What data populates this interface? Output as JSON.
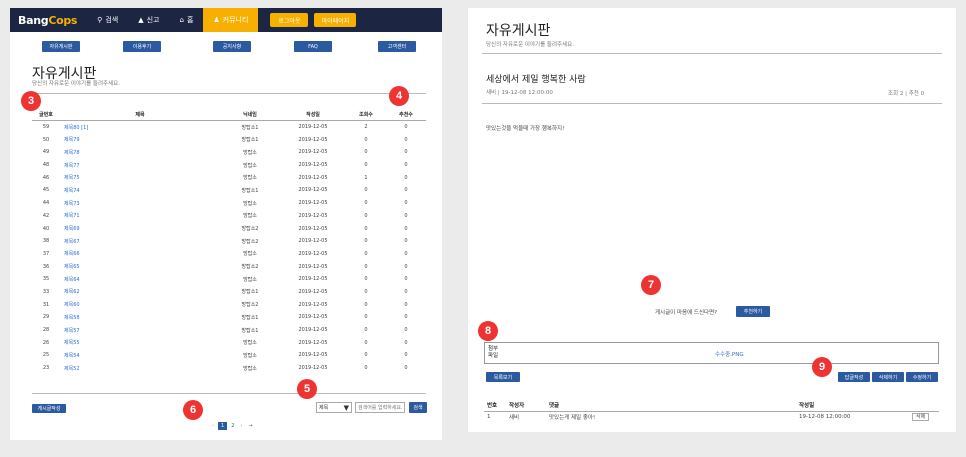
{
  "brand": {
    "left": "Bang",
    "right": "Cops"
  },
  "nav": {
    "search": "검색",
    "report": "신고",
    "home": "홈",
    "community": "커뮤니티",
    "logout": "로그아웃",
    "mypage": "마이페이지"
  },
  "subnav": [
    "자유게시판",
    "이용후기",
    "공지사항",
    "FAQ",
    "고객센터"
  ],
  "board": {
    "title": "자유게시판",
    "subtitle": "당신의 자유로운 이야기를 들려주세요.",
    "headers": [
      "글번호",
      "제목",
      "닉네임",
      "작성일",
      "조회수",
      "추천수"
    ],
    "rows": [
      [
        "59",
        "제목80 [1]",
        "방탑소1",
        "2019-12-05",
        "2",
        "0"
      ],
      [
        "50",
        "제목79",
        "방탑소1",
        "2019-12-05",
        "0",
        "0"
      ],
      [
        "49",
        "제목78",
        "방탑소",
        "2019-12-05",
        "0",
        "0"
      ],
      [
        "48",
        "제목77",
        "방탑소",
        "2019-12-05",
        "0",
        "0"
      ],
      [
        "46",
        "제목75",
        "방탑소",
        "2019-12-05",
        "1",
        "0"
      ],
      [
        "45",
        "제목74",
        "방탑소1",
        "2019-12-05",
        "0",
        "0"
      ],
      [
        "44",
        "제목73",
        "방탑소",
        "2019-12-05",
        "0",
        "0"
      ],
      [
        "42",
        "제목71",
        "방탑소",
        "2019-12-05",
        "0",
        "0"
      ],
      [
        "40",
        "제목69",
        "방탑소2",
        "2019-12-05",
        "0",
        "0"
      ],
      [
        "38",
        "제목67",
        "방탑소2",
        "2019-12-05",
        "0",
        "0"
      ],
      [
        "37",
        "제목66",
        "방탑소",
        "2019-12-05",
        "0",
        "0"
      ],
      [
        "36",
        "제목65",
        "방탑소2",
        "2019-12-05",
        "0",
        "0"
      ],
      [
        "35",
        "제목64",
        "방탑소",
        "2019-12-05",
        "0",
        "0"
      ],
      [
        "33",
        "제목62",
        "방탑소1",
        "2019-12-05",
        "0",
        "0"
      ],
      [
        "31",
        "제목60",
        "방탑소2",
        "2019-12-05",
        "0",
        "0"
      ],
      [
        "29",
        "제목58",
        "방탑소1",
        "2019-12-05",
        "0",
        "0"
      ],
      [
        "28",
        "제목57",
        "방탑소1",
        "2019-12-05",
        "0",
        "0"
      ],
      [
        "26",
        "제목55",
        "방탑소",
        "2019-12-05",
        "0",
        "0"
      ],
      [
        "25",
        "제목54",
        "방탑소",
        "2019-12-05",
        "0",
        "0"
      ],
      [
        "23",
        "제목52",
        "방탑소",
        "2019-12-05",
        "0",
        "0"
      ]
    ],
    "write_btn": "게시글작성",
    "search_select": "제목",
    "search_placeholder": "검색어를 입력하세요.",
    "search_btn": "검색",
    "pages": [
      "‹",
      "1",
      "2",
      "›",
      "→"
    ]
  },
  "post": {
    "board_title": "자유게시판",
    "board_sub": "당신의 자유로운 이야기를 들려주세요.",
    "title": "세상에서 제일 행복한 사람",
    "meta": "새비 | 19-12-08 12:00:00",
    "views": "조회 2 | 추천 0",
    "content": "맛있는것을 먹을때 가장 행복하지!",
    "recommend_q": "게시글이 마음에 드신다면?",
    "recommend_btn": "추천하기",
    "attach_label": "첨부\n파일",
    "attach_file": "수수중.PNG",
    "list_btn": "목록보기",
    "reply_btn": "답글작성",
    "delete_btn": "삭제하기",
    "edit_btn": "수정하기",
    "comment_headers": [
      "번호",
      "작성자",
      "댓글",
      "작성일"
    ],
    "comments": [
      [
        "1",
        "새비",
        "맛있는게 제일 좋아!",
        "19-12-08 12:00:00",
        "삭제"
      ]
    ]
  },
  "badges": [
    "3",
    "4",
    "5",
    "6",
    "7",
    "8",
    "9"
  ]
}
